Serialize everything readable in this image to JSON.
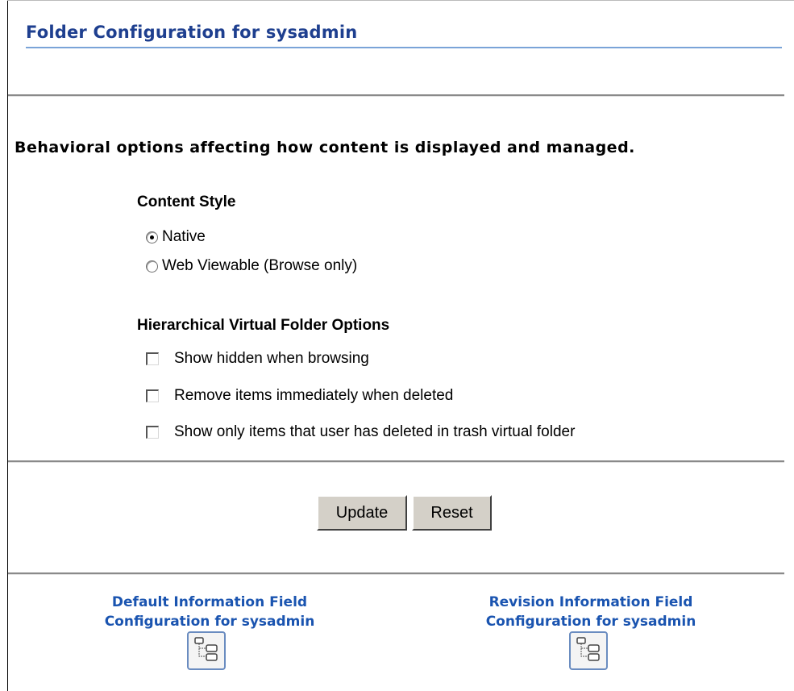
{
  "header": {
    "title": "Folder Configuration for sysadmin"
  },
  "description": "Behavioral options affecting how content is displayed and managed.",
  "content_style": {
    "heading": "Content Style",
    "options": [
      {
        "label": "Native",
        "selected": true
      },
      {
        "label": "Web Viewable (Browse only)",
        "selected": false
      }
    ]
  },
  "virtual_folder_options": {
    "heading": "Hierarchical Virtual Folder Options",
    "options": [
      {
        "label": "Show hidden when browsing",
        "checked": false
      },
      {
        "label": "Remove items immediately when deleted",
        "checked": false
      },
      {
        "label": "Show only items that user has deleted in trash virtual folder",
        "checked": false
      }
    ]
  },
  "buttons": {
    "update": "Update",
    "reset": "Reset"
  },
  "links": {
    "default_info": {
      "line1": "Default Information Field",
      "line2": "Configuration for sysadmin",
      "icon": "folder-tree-icon"
    },
    "revision_info": {
      "line1": "Revision Information Field",
      "line2": "Configuration for sysadmin",
      "icon": "folder-tree-icon"
    }
  },
  "colors": {
    "title": "#1e3f8f",
    "link": "#1a54b0",
    "button_face": "#d4d0c8"
  }
}
